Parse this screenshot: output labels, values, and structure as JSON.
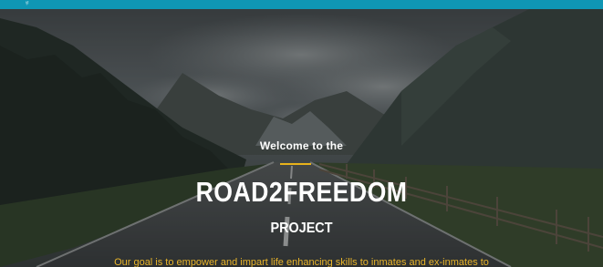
{
  "header": {
    "mark": "ᵞᴵ",
    "color": "#0f96b4"
  },
  "hero": {
    "welcome": "Welcome to the",
    "title": "ROAD2FREEDOM",
    "subtitle": "PROJECT",
    "goal": "Our goal is to empower and  impart life enhancing skills to inmates and ex-inmates to",
    "accent_color": "#e7b21b",
    "background": "mountain-road-photo"
  }
}
